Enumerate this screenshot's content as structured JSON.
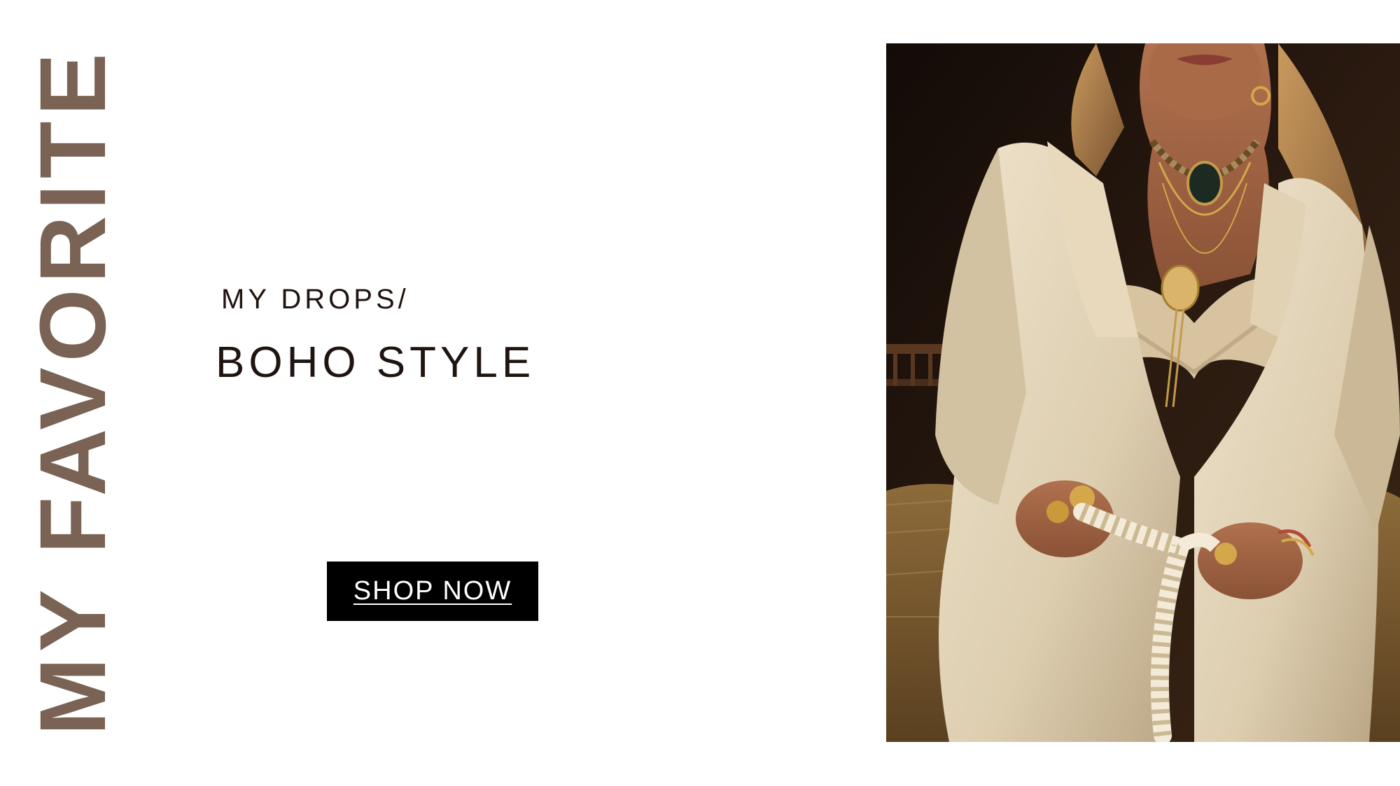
{
  "brand": {
    "vertical_title": "MY FAVORITE",
    "color": "#7a6354"
  },
  "hero": {
    "subtitle": "MY DROPS/",
    "headline": "BOHO STYLE",
    "text_color": "#1f1410"
  },
  "cta": {
    "label": "SHOP NOW",
    "background": "#000000",
    "text_color": "#ffffff"
  },
  "photo": {
    "description_icon": "model-photo"
  }
}
